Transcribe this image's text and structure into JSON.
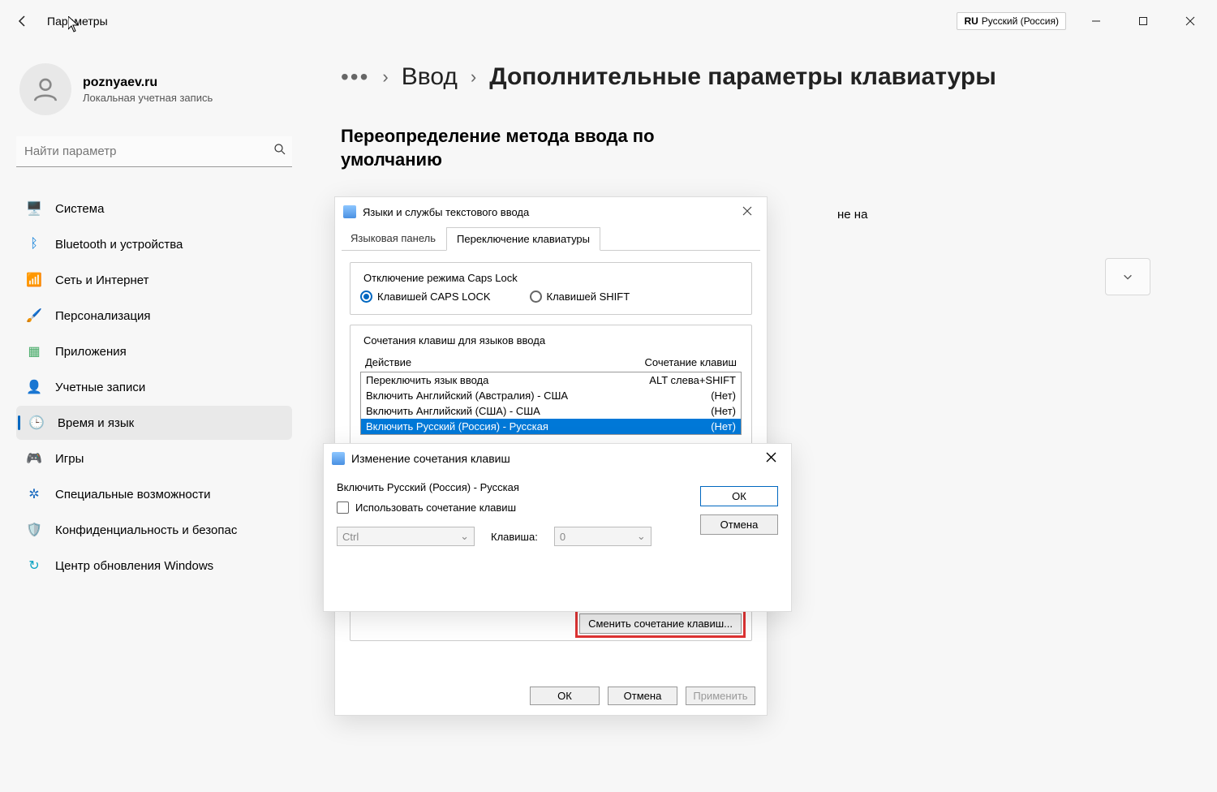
{
  "titlebar": {
    "app_title": "Параметры",
    "lang_code": "RU",
    "lang_name": "Русский (Россия)"
  },
  "user": {
    "name": "poznyaev.ru",
    "subtitle": "Локальная учетная запись"
  },
  "search": {
    "placeholder": "Найти параметр"
  },
  "nav": {
    "items": [
      {
        "label": "Система",
        "icon": "🖥️",
        "color": "#0078d7"
      },
      {
        "label": "Bluetooth и устройства",
        "icon": "ᛒ",
        "color": "#0078d7"
      },
      {
        "label": "Сеть и Интернет",
        "icon": "📶",
        "color": "#0aa3c2"
      },
      {
        "label": "Персонализация",
        "icon": "🖌️",
        "color": "#c06a2a"
      },
      {
        "label": "Приложения",
        "icon": "▦",
        "color": "#4a6"
      },
      {
        "label": "Учетные записи",
        "icon": "👤",
        "color": "#2a9d5a"
      },
      {
        "label": "Время и язык",
        "icon": "🕒",
        "color": "#555"
      },
      {
        "label": "Игры",
        "icon": "🎮",
        "color": "#888"
      },
      {
        "label": "Специальные возможности",
        "icon": "✲",
        "color": "#1a6abf"
      },
      {
        "label": "Конфиденциальность и безопас",
        "icon": "🛡️",
        "color": "#777"
      },
      {
        "label": "Центр обновления Windows",
        "icon": "↻",
        "color": "#0aa3c2"
      }
    ],
    "selected_index": 6
  },
  "breadcrumb": {
    "link": "Ввод",
    "current": "Дополнительные параметры клавиатуры"
  },
  "main": {
    "section_heading": "Переопределение метода ввода по умолчанию",
    "behind_text_fragment": "не на"
  },
  "dialog1": {
    "title": "Языки и службы текстового ввода",
    "tabs": {
      "inactive": "Языковая панель",
      "active": "Переключение клавиатуры"
    },
    "capslock": {
      "legend": "Отключение режима Caps Lock",
      "opt1": "Клавишей CAPS LOCK",
      "opt2": "Клавишей SHIFT"
    },
    "hotkeys": {
      "legend": "Сочетания клавиш для языков ввода",
      "col_action": "Действие",
      "col_combo": "Сочетание клавиш",
      "rows": [
        {
          "action": "Переключить язык ввода",
          "combo": "ALT слева+SHIFT"
        },
        {
          "action": "Включить Английский (Австралия) - США",
          "combo": "(Нет)"
        },
        {
          "action": "Включить Английский (США) - США",
          "combo": "(Нет)"
        },
        {
          "action": "Включить Русский (Россия) - Русская",
          "combo": "(Нет)"
        }
      ],
      "selected_index": 3,
      "change_btn": "Сменить сочетание клавиш..."
    },
    "footer": {
      "ok": "ОК",
      "cancel": "Отмена",
      "apply": "Применить"
    }
  },
  "dialog2": {
    "title": "Изменение сочетания клавиш",
    "subtitle": "Включить Русский (Россия) - Русская",
    "checkbox": "Использовать сочетание клавиш",
    "combo_ctrl": "Ctrl",
    "key_label": "Клавиша:",
    "key_value": "0",
    "ok": "ОК",
    "cancel": "Отмена"
  }
}
